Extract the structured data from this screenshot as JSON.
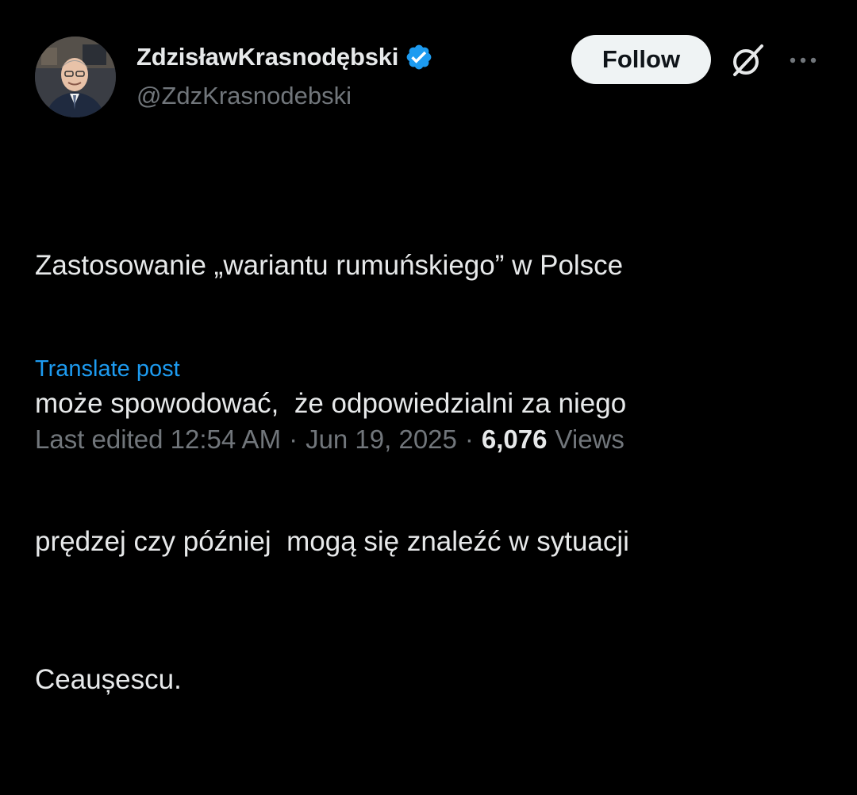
{
  "author": {
    "display_name": "ZdzisławKrasnodębski",
    "handle": "@ZdzKrasnodebski",
    "verified": true,
    "verified_color": "#1d9bf0"
  },
  "actions": {
    "follow_label": "Follow",
    "grok_icon": "grok-icon",
    "more_icon": "more-icon"
  },
  "post": {
    "lines": [
      "Zastosowanie „wariantu rumuńskiego” w Polsce",
      "może spowodować,  że odpowiedzialni za niego",
      "prędzej czy później  mogą się znaleźć w sytuacji",
      "Ceaușescu."
    ],
    "translate_label": "Translate post"
  },
  "meta": {
    "edited_label": "Last edited 12:54 AM",
    "separator": "·",
    "date": "Jun 19, 2025",
    "views_count": "6,076",
    "views_label": "Views"
  },
  "colors": {
    "background": "#000000",
    "text_primary": "#e7e9ea",
    "text_secondary": "#71767b",
    "link": "#1d9bf0",
    "follow_bg": "#eff3f4"
  }
}
